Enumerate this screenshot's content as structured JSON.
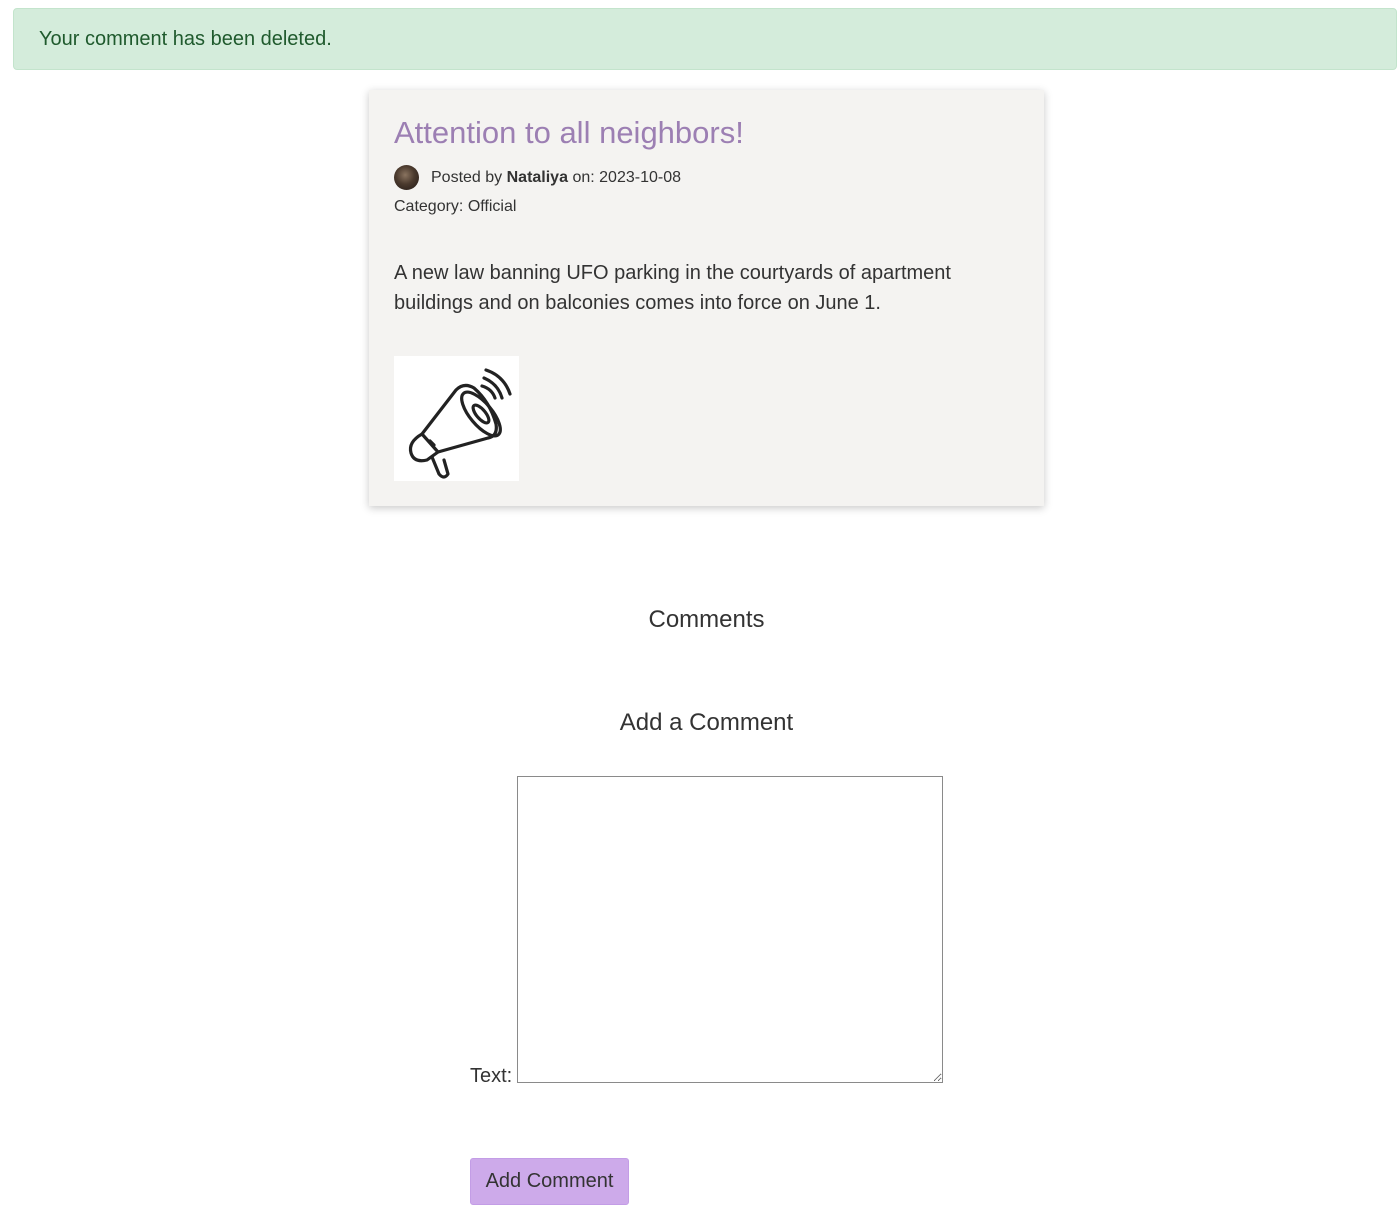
{
  "alert": {
    "message": "Your comment has been deleted.",
    "color": "#d4ecdb"
  },
  "post": {
    "title": "Attention to all neighbors!",
    "posted_by_prefix": "Posted by",
    "author": "Nataliya",
    "date_prefix": "on:",
    "date": "2023-10-08",
    "category_label": "Category:",
    "category": "Official",
    "body": "A new law banning UFO parking in the courtyards of apartment buildings and on balconies comes into force on June 1.",
    "image_icon": "megaphone-icon",
    "title_color": "#9c7fb3"
  },
  "comments": {
    "heading": "Comments"
  },
  "add_comment": {
    "heading": "Add a Comment",
    "text_label": "Text:",
    "text_value": "",
    "submit_label": "Add Comment",
    "button_color": "#cdaaea"
  }
}
